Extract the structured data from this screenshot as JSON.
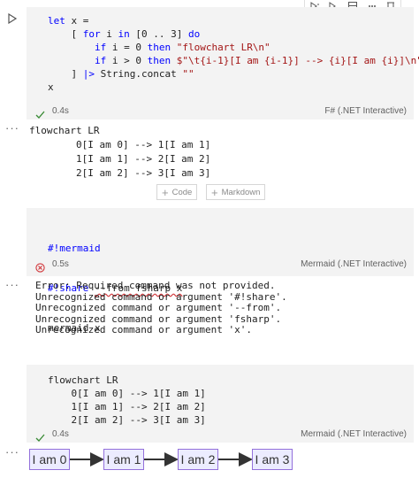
{
  "cell1": {
    "code_lines": [
      [
        {
          "t": "let",
          "c": "kw"
        },
        {
          "t": " x =",
          "c": "plain"
        }
      ],
      [
        {
          "t": "    [ ",
          "c": "plain"
        },
        {
          "t": "for",
          "c": "kw"
        },
        {
          "t": " i ",
          "c": "plain"
        },
        {
          "t": "in",
          "c": "kw"
        },
        {
          "t": " [0 .. 3] ",
          "c": "plain"
        },
        {
          "t": "do",
          "c": "kw"
        }
      ],
      [
        {
          "t": "        ",
          "c": "plain"
        },
        {
          "t": "if",
          "c": "kw"
        },
        {
          "t": " i = 0 ",
          "c": "plain"
        },
        {
          "t": "then",
          "c": "kw"
        },
        {
          "t": " ",
          "c": "plain"
        },
        {
          "t": "\"flowchart LR\\n\"",
          "c": "str"
        }
      ],
      [
        {
          "t": "        ",
          "c": "plain"
        },
        {
          "t": "if",
          "c": "kw"
        },
        {
          "t": " i > 0 ",
          "c": "plain"
        },
        {
          "t": "then",
          "c": "kw"
        },
        {
          "t": " ",
          "c": "plain"
        },
        {
          "t": "$\"\\t{i-1}[I am {i-1}] --> {i}[I am {i}]\\n\"",
          "c": "str"
        }
      ],
      [
        {
          "t": "    ] ",
          "c": "plain"
        },
        {
          "t": "|>",
          "c": "kw"
        },
        {
          "t": " String.concat ",
          "c": "plain"
        },
        {
          "t": "\"\"",
          "c": "str"
        }
      ],
      [
        {
          "t": "x",
          "c": "plain"
        }
      ]
    ],
    "time": "0.4s",
    "language": "F# (.NET Interactive)"
  },
  "output1": {
    "lines": [
      "flowchart LR",
      "        0[I am 0] --> 1[I am 1]",
      "        1[I am 1] --> 2[I am 2]",
      "        2[I am 2] --> 3[I am 3]"
    ]
  },
  "add_cell": {
    "code_label": "Code",
    "markdown_label": "Markdown"
  },
  "cell2": {
    "line1": "#!mermaid",
    "line2_prefix": "#!share ",
    "line2_squiggle": "--from fsharp x",
    "line3": "mermaid x",
    "time": "0.5s",
    "language": "Mermaid (.NET Interactive)"
  },
  "output2": {
    "lines": [
      "Error: Required command was not provided.",
      "Unrecognized command or argument '#!share'.",
      "Unrecognized command or argument '--from'.",
      "Unrecognized command or argument 'fsharp'.",
      "Unrecognized command or argument 'x'."
    ]
  },
  "cell3": {
    "lines": [
      "flowchart LR",
      "    0[I am 0] --> 1[I am 1]",
      "    1[I am 1] --> 2[I am 2]",
      "    2[I am 2] --> 3[I am 3]"
    ],
    "time": "0.4s",
    "language": "Mermaid (.NET Interactive)"
  },
  "diagram": {
    "nodes": [
      "I am 0",
      "I am 1",
      "I am 2",
      "I am 3"
    ]
  },
  "colors": {
    "keyword": "#0000ff",
    "string": "#a31515",
    "success": "#388a34",
    "error": "#d13438",
    "node_border": "#9370db",
    "node_fill": "#ececff"
  }
}
